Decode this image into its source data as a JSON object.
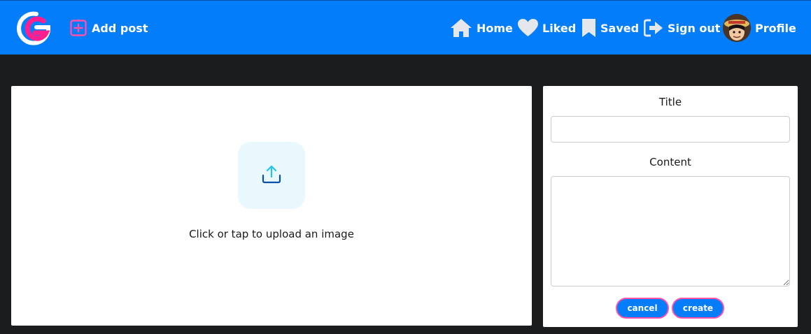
{
  "navbar": {
    "brand_icon": "g-logo-icon",
    "add_post_label": "Add post",
    "items": [
      {
        "label": "Home",
        "icon": "home-icon"
      },
      {
        "label": "Liked",
        "icon": "heart-icon"
      },
      {
        "label": "Saved",
        "icon": "bookmark-icon"
      },
      {
        "label": "Sign out",
        "icon": "sign-out-icon"
      },
      {
        "label": "Profile",
        "icon": "avatar"
      }
    ]
  },
  "upload": {
    "icon": "upload-icon",
    "text": "Click or tap to upload an image"
  },
  "form": {
    "title_label": "Title",
    "title_value": "",
    "content_label": "Content",
    "content_value": "",
    "cancel_label": "cancel",
    "create_label": "create"
  },
  "colors": {
    "navbar": "#047dfb",
    "background": "#1b1c1e",
    "accent_pink": "#ff4fa8",
    "upload_tile": "#e8f8fd"
  }
}
